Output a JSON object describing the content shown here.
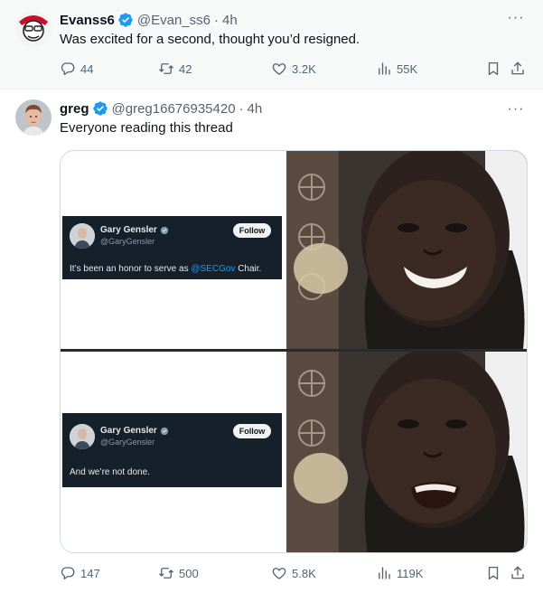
{
  "posts": [
    {
      "author": {
        "name": "Evanss6",
        "handle": "@Evan_ss6",
        "time": "4h",
        "verified": true
      },
      "text": "Was excited for a second, thought you’d resigned.",
      "actions": {
        "replies": "44",
        "reposts": "42",
        "likes": "3.2K",
        "views": "55K"
      }
    },
    {
      "author": {
        "name": "greg",
        "handle": "@greg16676935420",
        "time": "4h",
        "verified": true
      },
      "text": "Everyone reading this thread",
      "actions": {
        "replies": "147",
        "reposts": "500",
        "likes": "5.8K",
        "views": "119K"
      },
      "media": {
        "top_card": {
          "name": "Gary Gensler",
          "handle": "@GaryGensler",
          "follow_label": "Follow",
          "text_before": "It’s been an honor to serve as ",
          "mention": "@SECGov",
          "text_after": " Chair."
        },
        "bottom_card": {
          "name": "Gary Gensler",
          "handle": "@GaryGensler",
          "follow_label": "Follow",
          "text": "And we’re not done."
        }
      }
    }
  ],
  "separator": "·",
  "more_label": "···",
  "icons": [
    "reply-icon",
    "repost-icon",
    "like-icon",
    "views-icon",
    "bookmark-icon",
    "share-icon",
    "verified-badge-icon",
    "more-icon"
  ],
  "colors": {
    "accent": "#1d9bf0",
    "text": "#0f1419",
    "muted": "#536471",
    "card_bg": "#15202b"
  }
}
